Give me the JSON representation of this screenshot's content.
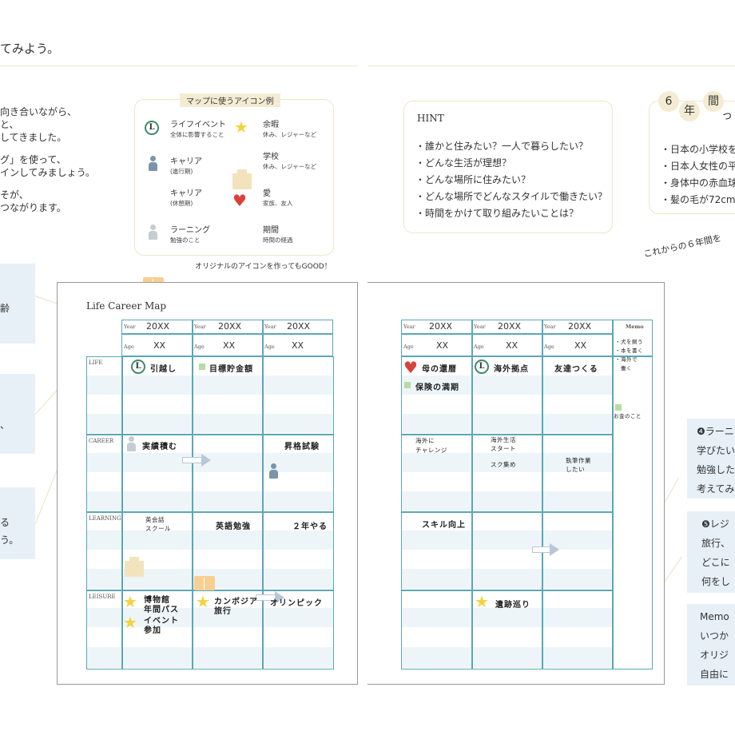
{
  "header": {
    "title": "てみよう。"
  },
  "intro": {
    "lines": [
      "向き合いながら、",
      "と、",
      "してきました。",
      "グ」を使って、",
      "インしてみましょう。",
      "そが、",
      "つながります。"
    ]
  },
  "legend": {
    "title": "マップに使うアイコン例",
    "items": [
      {
        "label": "ライフイベント",
        "sub": "全体に影響すること",
        "icon": "L"
      },
      {
        "label": "余暇",
        "sub": "休み、レジャーなど"
      },
      {
        "label": "キャリア",
        "sub": "(進行期)"
      },
      {
        "label": "学校",
        "sub": "休み、レジャーなど"
      },
      {
        "label": "キャリア",
        "sub": "(休憩期)"
      },
      {
        "label": "愛",
        "sub": "家族、友人"
      },
      {
        "label": "ラーニング",
        "sub": "勉強のこと"
      },
      {
        "label": "期間",
        "sub": "時間の経過"
      }
    ],
    "note": "オリジナルのアイコンを作ってもGOOD！"
  },
  "hint": {
    "title": "HINT",
    "items": [
      "・誰かと住みたい？一人で暮らしたい？",
      "・どんな生活が理想？",
      "・どんな場所に住みたい？",
      "・どんな場所でどんなスタイルで働きたい？",
      "・時間をかけて取り組みたいことは？"
    ]
  },
  "six_years": {
    "bubbles": [
      "6",
      "年",
      "間",
      "っ"
    ],
    "items": [
      "・日本の小学校を",
      "・日本人女性の平",
      "・身体中の赤血球",
      "・髪の毛が72cm"
    ]
  },
  "caption_right": "これからの６年間を",
  "left_side": {
    "box1": [
      "齢"
    ],
    "box2": [
      "、"
    ],
    "box3": [
      "る",
      "う。"
    ]
  },
  "right_side": {
    "box1": [
      "❹ラーニ",
      "学びたい",
      "勉強した",
      "考えてみ"
    ],
    "box2": [
      "❺レジ",
      "旅行、",
      "どこに",
      "何をし"
    ],
    "box3": [
      "Memo",
      "いつか",
      "オリジ",
      "自由に"
    ]
  },
  "map_left": {
    "title": "Life Career Map",
    "year_label": "Year",
    "age_label": "Age",
    "years": [
      "20XX",
      "20XX",
      "20XX"
    ],
    "ages": [
      "XX",
      "XX",
      "XX"
    ],
    "sections": [
      "LIFE",
      "CAREER",
      "LEARNING",
      "LEISURE"
    ],
    "entries": {
      "life1": "引越し",
      "life2": "目標貯金額",
      "career1": "実績積む",
      "career3": "昇格試験",
      "learn1a": "英会話",
      "learn1b": "スクール",
      "learn2": "英語勉強",
      "learn3": "２年やる",
      "leisure1a": "博物館",
      "leisure1b": "年間パス",
      "leisure1c": "イベント",
      "leisure1d": "参加",
      "leisure2a": "カンボジア",
      "leisure2b": "旅行",
      "leisure3": "オリンピック"
    }
  },
  "map_right": {
    "year_label": "Year",
    "age_label": "Age",
    "years": [
      "20XX",
      "20XX",
      "20XX"
    ],
    "ages": [
      "XX",
      "XX",
      "XX"
    ],
    "memo_title": "Memo",
    "memo_lines": [
      "・犬を飼う",
      "・本を書く",
      "・海外で",
      "　働く"
    ],
    "memo_money": "お金のこと",
    "entries": {
      "life1": "母の還暦",
      "life1b": "保険の満期",
      "life2": "海外拠点",
      "life3": "友達つくる",
      "career1a": "海外に",
      "career1b": "チャレンジ",
      "career2a": "海外生活",
      "career2b": "スタート",
      "career2c": "スク集め",
      "career3a": "執筆作業",
      "career3b": "したい",
      "learn1": "スキル向上",
      "leisure2": "遺跡巡り"
    }
  }
}
